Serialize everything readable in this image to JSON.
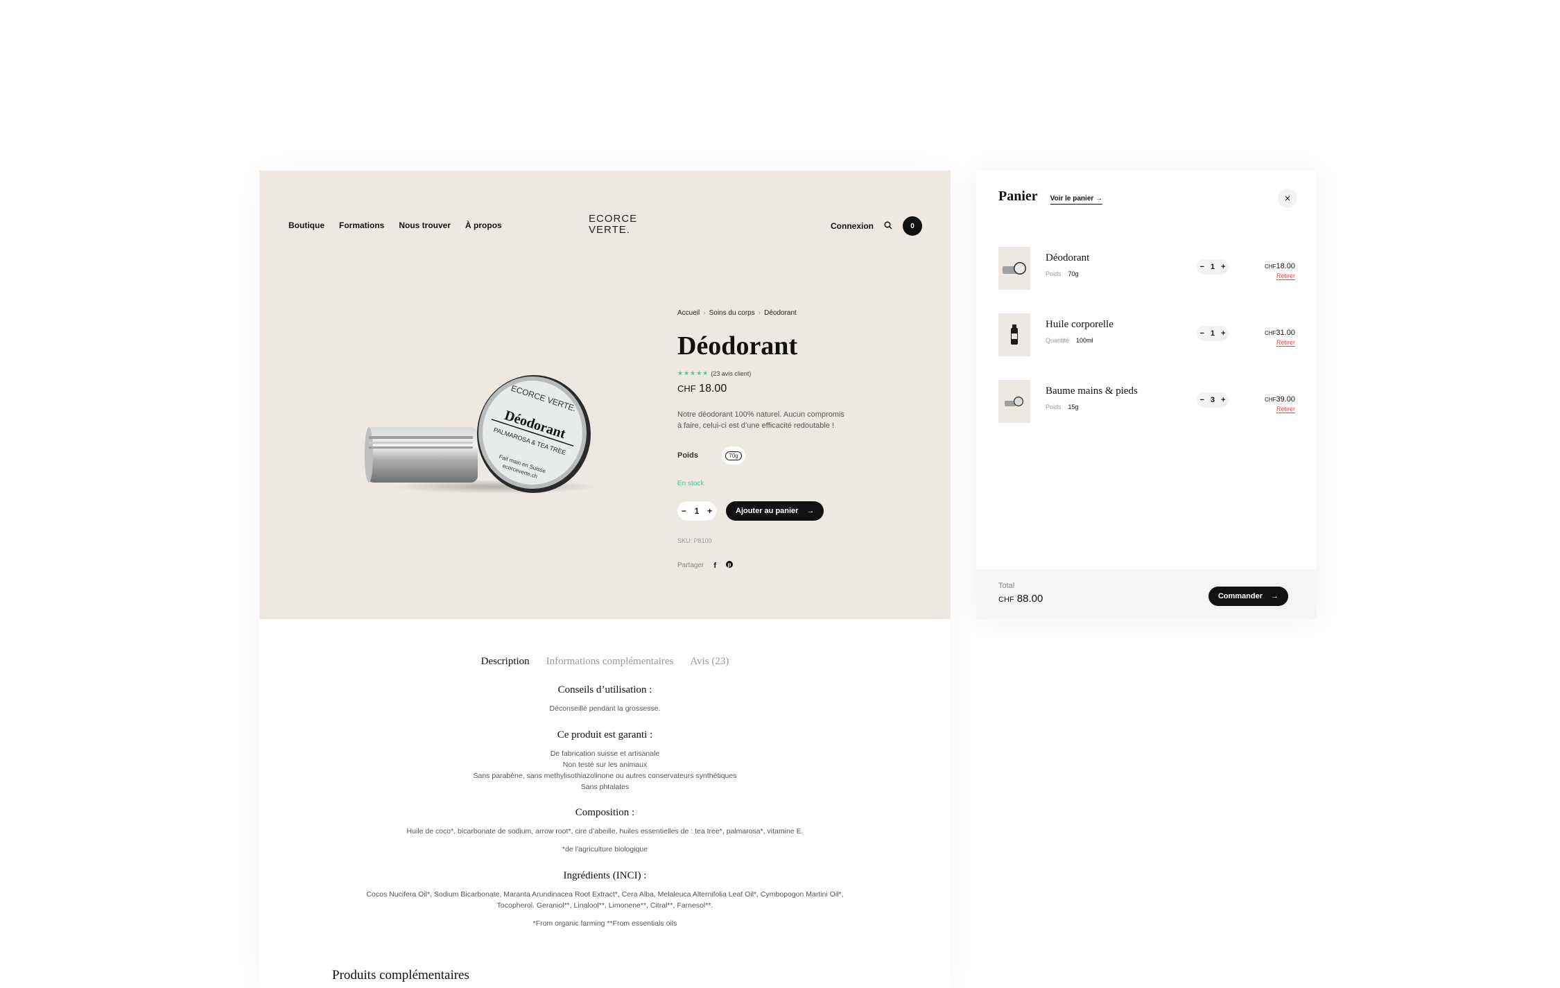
{
  "nav": {
    "links": [
      "Boutique",
      "Formations",
      "Nous trouver",
      "À propos"
    ],
    "logo_line1": "ECORCE",
    "logo_line2": "VERTE.",
    "login": "Connexion",
    "cart_count": "0"
  },
  "product": {
    "breadcrumb": [
      "Accueil",
      "Soins du corps",
      "Déodorant"
    ],
    "title": "Déodorant",
    "stars": "★★★★★",
    "rating_text": "(23 avis client)",
    "price_currency": "CHF",
    "price_value": "18.00",
    "description": "Notre déodorant 100% naturel. Aucun compromis à faire, celui-ci est d’une efficacité redoutable !",
    "weight_label": "Poids",
    "weight_option": "70g",
    "stock": "En stock",
    "qty": "1",
    "add_label": "Ajouter au panier",
    "sku": "SKU: P8100",
    "share_label": "Partager",
    "tin_label_title": "Déodorant",
    "tin_label_sub": "PALMAROSA & TEA TREE",
    "tin_label_brand": "ECORCE VERTE.",
    "tin_label_made": "Fait main en Suisse",
    "tin_label_url": "ecorceverte.ch"
  },
  "tabs": [
    "Description",
    "Informations complémentaires",
    "Avis (23)"
  ],
  "description": {
    "usage_title": "Conseils d’utilisation :",
    "usage_text": "Déconseillé pendant la grossesse.",
    "guarantee_title": "Ce produit est garanti :",
    "guarantee_lines": [
      "De fabrication suisse et artisanale",
      "Non testé sur les animaux",
      "Sans parabène, sans methylisothiazolinone ou autres conservateurs synthétiques",
      "Sans phtalates"
    ],
    "composition_title": "Composition :",
    "composition_text": "Huile de coco*, bicarbonate de sodium, arrow root*, cire d’abeille, huiles essentielles de : tea tree*, palmarosa*, vitamine E.",
    "composition_note": "*de l’agriculture biologique",
    "inci_title": "Ingrédients (INCI) :",
    "inci_line1": "Cocos Nucifera Oil*, Sodium Bicarbonate, Maranta Arundinacea Root Extract*, Cera Alba, Melaleuca Alternifolia Leaf Oil*, Cymbopogon Martini Oil*,",
    "inci_line2": "Tocopherol. Geraniol**, Linalool**, Limonene**, Citral**, Farnesol**.",
    "inci_note": "*From organic farming **From essentials oils",
    "related_title": "Produits complémentaires"
  },
  "cart": {
    "title": "Panier",
    "view_link": "Voir le panier",
    "items": [
      {
        "name": "Déodorant",
        "meta_key": "Poids",
        "meta_val": "70g",
        "qty": "1",
        "currency": "CHF",
        "price": "18.00",
        "remove": "Retirer"
      },
      {
        "name": "Huile corporelle",
        "meta_key": "Quantité",
        "meta_val": "100ml",
        "qty": "1",
        "currency": "CHF",
        "price": "31.00",
        "remove": "Retirer"
      },
      {
        "name": "Baume mains & pieds",
        "meta_key": "Poids",
        "meta_val": "15g",
        "qty": "3",
        "currency": "CHF",
        "price": "39.00",
        "remove": "Retirer"
      }
    ],
    "total_label": "Total",
    "total_currency": "CHF",
    "total_value": "88.00",
    "checkout_label": "Commander"
  },
  "colors": {
    "hero_bg": "#ede8e2",
    "accent_green": "#3ccf8e",
    "remove_red": "#e04848",
    "primary": "#111111"
  }
}
